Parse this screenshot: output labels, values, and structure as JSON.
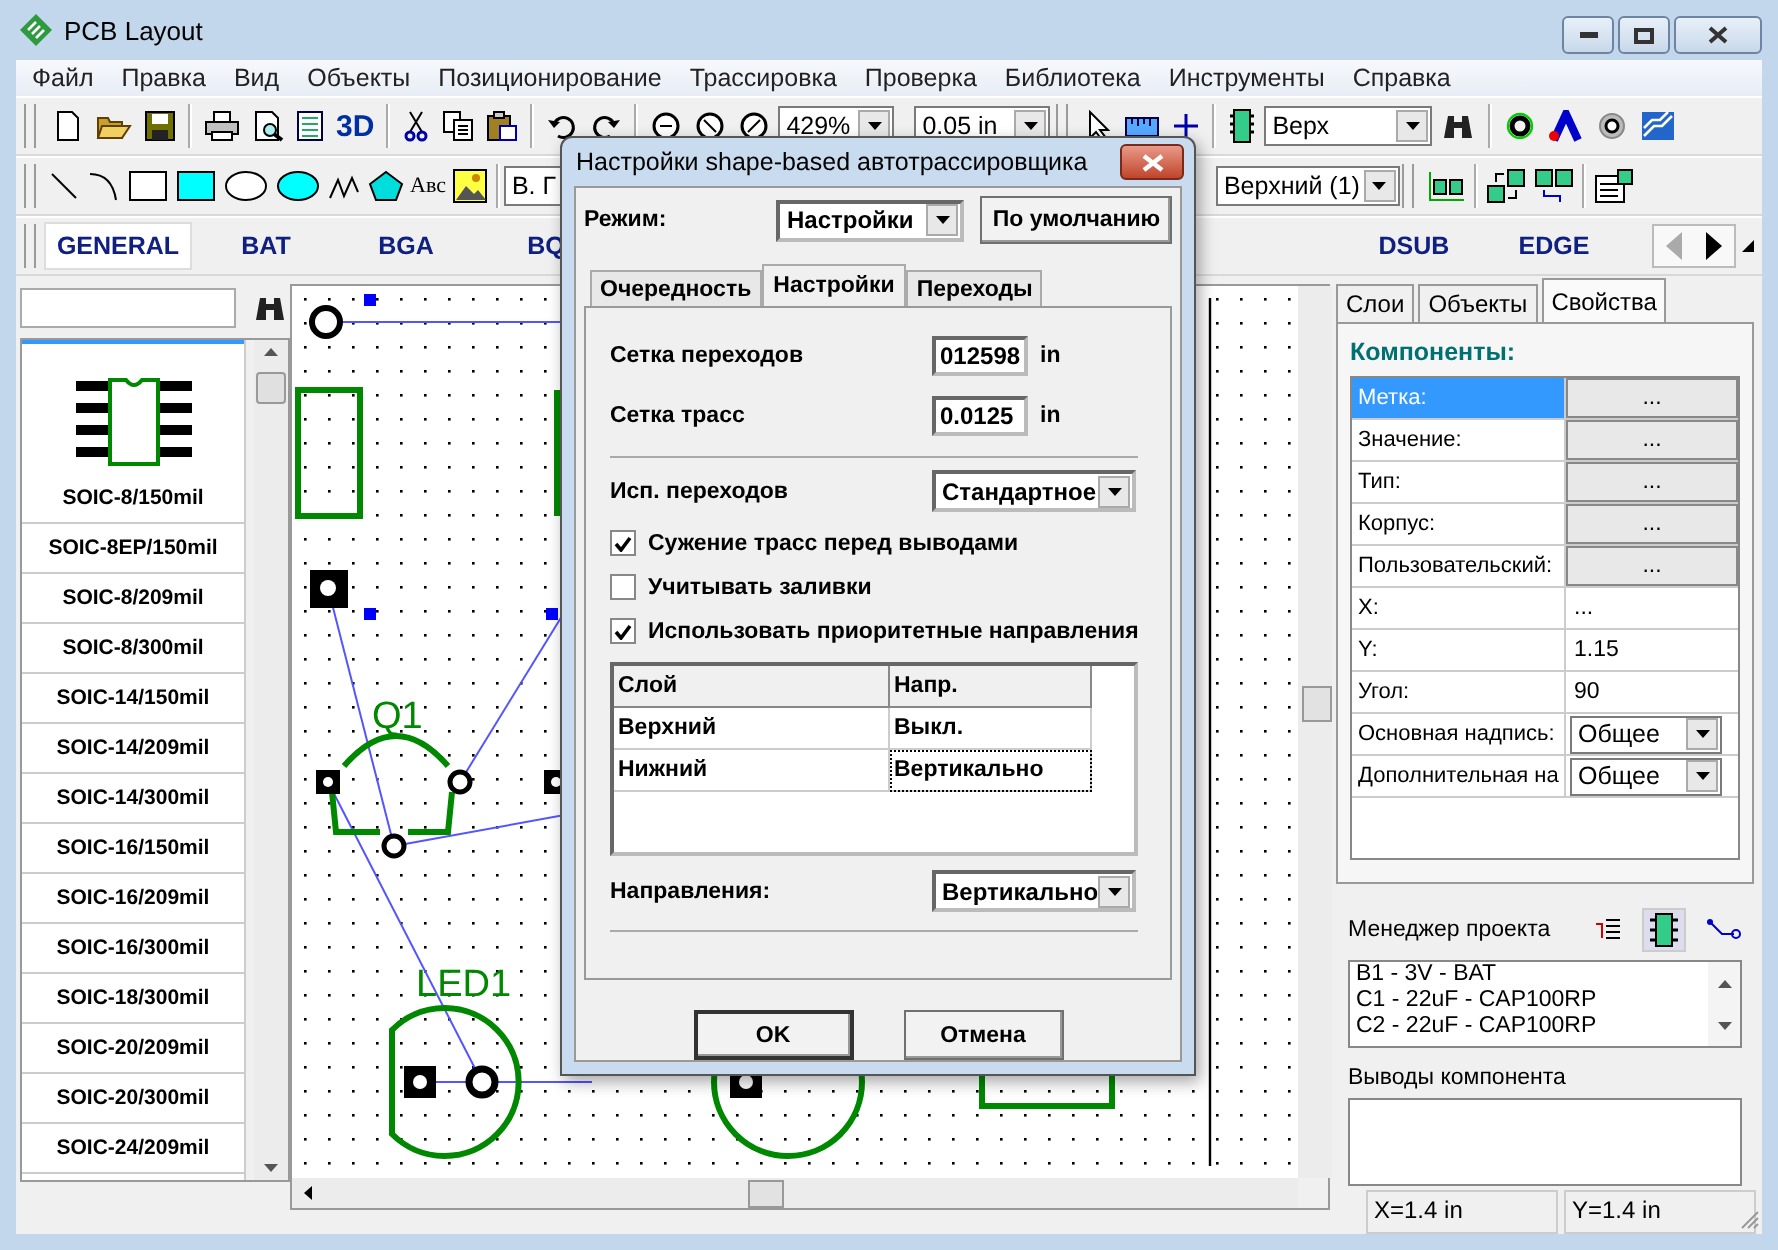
{
  "window": {
    "title": "PCB Layout"
  },
  "menu": [
    "Файл",
    "Правка",
    "Вид",
    "Объекты",
    "Позиционирование",
    "Трассировка",
    "Проверка",
    "Библиотека",
    "Инструменты",
    "Справка"
  ],
  "toolbar": {
    "view_3d": "3D",
    "zoom": "429%",
    "grid_step": "0.05 in",
    "side": "Верх",
    "text_tool": "Авс",
    "font": "В. Г",
    "layer": "Верхний (1)"
  },
  "library_tabs": [
    {
      "label": "GENERAL",
      "selected": true
    },
    {
      "label": "BAT",
      "selected": false
    },
    {
      "label": "BGA",
      "selected": false
    },
    {
      "label": "BQ",
      "selected": false
    },
    {
      "label": "DSUB",
      "selected": false
    },
    {
      "label": "EDGE",
      "selected": false
    }
  ],
  "library": {
    "items": [
      {
        "label": "SOIC-8/150mil",
        "selected": true
      },
      {
        "label": "SOIC-8EP/150mil",
        "selected": false
      },
      {
        "label": "SOIC-8/209mil",
        "selected": false
      },
      {
        "label": "SOIC-8/300mil",
        "selected": false
      },
      {
        "label": "SOIC-14/150mil",
        "selected": false
      },
      {
        "label": "SOIC-14/209mil",
        "selected": false
      },
      {
        "label": "SOIC-14/300mil",
        "selected": false
      },
      {
        "label": "SOIC-16/150mil",
        "selected": false
      },
      {
        "label": "SOIC-16/209mil",
        "selected": false
      },
      {
        "label": "SOIC-16/300mil",
        "selected": false
      },
      {
        "label": "SOIC-18/300mil",
        "selected": false
      },
      {
        "label": "SOIC-20/209mil",
        "selected": false
      },
      {
        "label": "SOIC-20/300mil",
        "selected": false
      },
      {
        "label": "SOIC-24/209mil",
        "selected": false
      }
    ]
  },
  "canvas": {
    "components": [
      {
        "label": "Q1"
      },
      {
        "label": "LED1"
      }
    ]
  },
  "side_panel": {
    "tabs": [
      {
        "label": "Слои",
        "selected": false
      },
      {
        "label": "Объекты",
        "selected": false
      },
      {
        "label": "Свойства",
        "selected": true
      }
    ],
    "heading": "Компоненты:",
    "properties": [
      {
        "label": "Метка:",
        "kind": "button",
        "value": "...",
        "selected": true
      },
      {
        "label": "Значение:",
        "kind": "button",
        "value": "...",
        "selected": false
      },
      {
        "label": "Тип:",
        "kind": "button",
        "value": "...",
        "selected": false
      },
      {
        "label": "Корпус:",
        "kind": "button",
        "value": "...",
        "selected": false
      },
      {
        "label": "Пользовательский:",
        "kind": "button",
        "value": "...",
        "selected": false
      },
      {
        "label": "X:",
        "kind": "text",
        "value": "...",
        "selected": false
      },
      {
        "label": "Y:",
        "kind": "text",
        "value": "1.15",
        "selected": false
      },
      {
        "label": "Угол:",
        "kind": "text",
        "value": "90",
        "selected": false
      },
      {
        "label": "Основная надпись:",
        "kind": "combo",
        "value": "Общее",
        "selected": false
      },
      {
        "label": "Дополнительная на",
        "kind": "combo",
        "value": "Общее",
        "selected": false
      }
    ]
  },
  "project_manager": {
    "title": "Менеджер проекта",
    "components": [
      "B1 - 3V - BAT",
      "C1 - 22uF - CAP100RP",
      "C2 - 22uF - CAP100RP"
    ],
    "pins_title": "Выводы компонента"
  },
  "status_bar": [
    "X=1.4 in",
    "Y=1.4 in"
  ],
  "dialog": {
    "title": "Настройки shape-based автотрассировщика",
    "mode_label": "Режим:",
    "mode": "Настройки",
    "default_button": "По умолчанию",
    "tabs": [
      {
        "label": "Очередность",
        "selected": false
      },
      {
        "label": "Настройки",
        "selected": true
      },
      {
        "label": "Переходы",
        "selected": false
      }
    ],
    "fields": [
      {
        "label": "Сетка переходов",
        "value": "012598",
        "unit": "in"
      },
      {
        "label": "Сетка трасс",
        "value": "0.0125",
        "unit": "in"
      }
    ],
    "via_label": "Исп. переходов",
    "via": "Стандартное",
    "checkboxes": [
      {
        "label": "Сужение трасс перед выводами",
        "checked": true
      },
      {
        "label": "Учитывать заливки",
        "checked": false
      },
      {
        "label": "Использовать приоритетные направления",
        "checked": true
      }
    ],
    "table": {
      "columns": [
        "Слой",
        "Напр."
      ],
      "rows": [
        {
          "cells": [
            "Верхний",
            "Выкл."
          ],
          "selected": false
        },
        {
          "cells": [
            "Нижний",
            "Вертикально"
          ],
          "selected": true
        }
      ]
    },
    "direction_label": "Направления:",
    "direction": "Вертикально",
    "buttons": [
      "OK",
      "Отмена"
    ]
  }
}
